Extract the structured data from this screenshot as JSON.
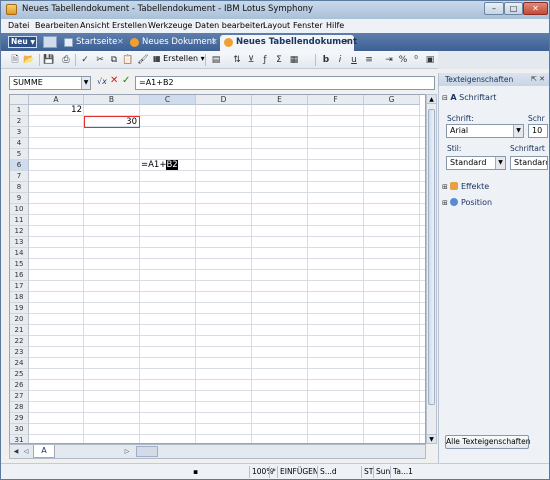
{
  "window": {
    "title": "Neues Tabellendokument - Tabellendokument - IBM Lotus Symphony"
  },
  "menu": [
    "Datei",
    "Bearbeiten",
    "Ansicht",
    "Erstellen",
    "Werkzeuge",
    "Daten bearbeiten",
    "Layout",
    "Fenster",
    "Hilfe"
  ],
  "tabs": {
    "new_button": "Neu",
    "items": [
      {
        "label": "Startseite",
        "icon": "home-icon"
      },
      {
        "label": "Neues Dokument",
        "icon": "document-icon"
      },
      {
        "label": "Neues Tabellendokument",
        "icon": "spreadsheet-icon",
        "active": true
      }
    ]
  },
  "toolbar": {
    "create_label": "Erstellen"
  },
  "formula_bar": {
    "name_box": "SUMME",
    "fx_label": "√x",
    "formula": "=A1+B2"
  },
  "grid": {
    "columns": [
      "A",
      "B",
      "C",
      "D",
      "E",
      "F",
      "G"
    ],
    "rows": [
      "1",
      "2",
      "3",
      "4",
      "5",
      "6",
      "7",
      "8",
      "9",
      "10",
      "11",
      "12",
      "13",
      "14",
      "15",
      "16",
      "17",
      "18",
      "19",
      "20",
      "21",
      "22",
      "23",
      "24",
      "25",
      "26",
      "27",
      "28",
      "29",
      "30",
      "31"
    ],
    "cells": {
      "A1": "12",
      "B2": "30",
      "C6_prefix": "=A1+",
      "C6_ref": "B2"
    },
    "selected_column": "C",
    "selected_row": "6"
  },
  "sheets": {
    "tab": "A"
  },
  "status": {
    "zoom": "100%",
    "modified": "*",
    "mode": "EINFÜGEN",
    "selection": "S...d",
    "st": "ST",
    "sum": "Sun",
    "ta": "Ta...1"
  },
  "sidebar": {
    "title": "Texteigenschaften",
    "section_font": "Schriftart",
    "font_label": "Schrift:",
    "font_value": "Arial",
    "size_label": "Schr",
    "size_value": "10",
    "style_label": "Stil:",
    "style_value": "Standard",
    "fontstyle_label": "Schriftart",
    "fontstyle_value": "Standard",
    "section_effects": "Effekte",
    "section_position": "Position",
    "all_props_button": "Alle Texteigenschaften"
  }
}
